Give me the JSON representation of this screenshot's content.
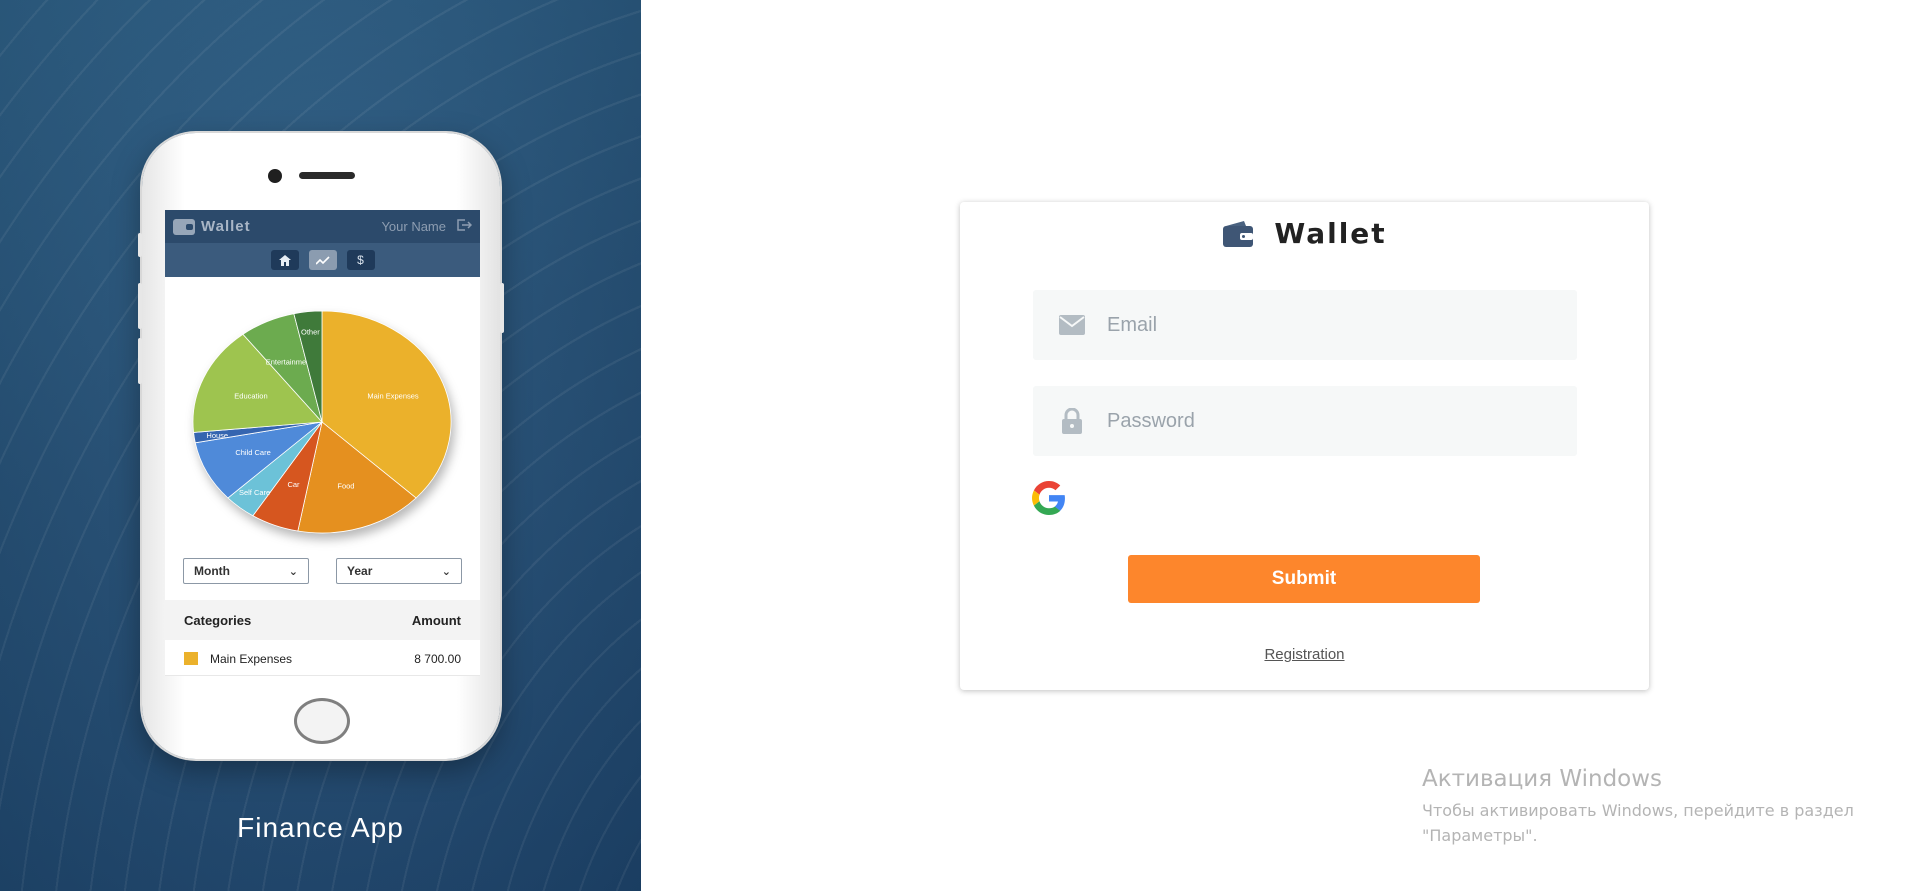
{
  "left_panel": {
    "caption": "Finance App"
  },
  "phone_app": {
    "brand": "Wallet",
    "user_name": "Your Name",
    "nav_icons": [
      "home-icon",
      "chart-icon",
      "dollar-icon"
    ],
    "filters": {
      "month_label": "Month",
      "year_label": "Year"
    },
    "table": {
      "header_category": "Categories",
      "header_amount": "Amount",
      "rows": [
        {
          "name": "Main Expenses",
          "amount": "8 700.00",
          "color": "#ebb12b"
        }
      ]
    }
  },
  "chart_data": {
    "type": "pie",
    "title": "",
    "slices": [
      {
        "label": "Main Expenses",
        "value": 37,
        "color": "#ebb12b"
      },
      {
        "label": "Food",
        "value": 16,
        "color": "#e5901f"
      },
      {
        "label": "Car",
        "value": 6,
        "color": "#d6561f"
      },
      {
        "label": "Self Care",
        "value": 4,
        "color": "#6cc2d8"
      },
      {
        "label": "Child Care",
        "value": 9,
        "color": "#4f8ad9"
      },
      {
        "label": "House",
        "value": 1.5,
        "color": "#3565b0"
      },
      {
        "label": "Education",
        "value": 16,
        "color": "#9ec44f"
      },
      {
        "label": "Entertainment",
        "value": 7,
        "color": "#6cab4f"
      },
      {
        "label": "Other",
        "value": 3.5,
        "color": "#3f7a3a"
      }
    ]
  },
  "login": {
    "brand": "Wallet",
    "email_placeholder": "Email",
    "password_placeholder": "Password",
    "submit_label": "Submit",
    "registration_label": "Registration",
    "accent_color": "#fd862c"
  },
  "watermark": {
    "title": "Активация Windows",
    "line1": "Чтобы активировать Windows, перейдите в раздел",
    "line2": "\"Параметры\"."
  }
}
